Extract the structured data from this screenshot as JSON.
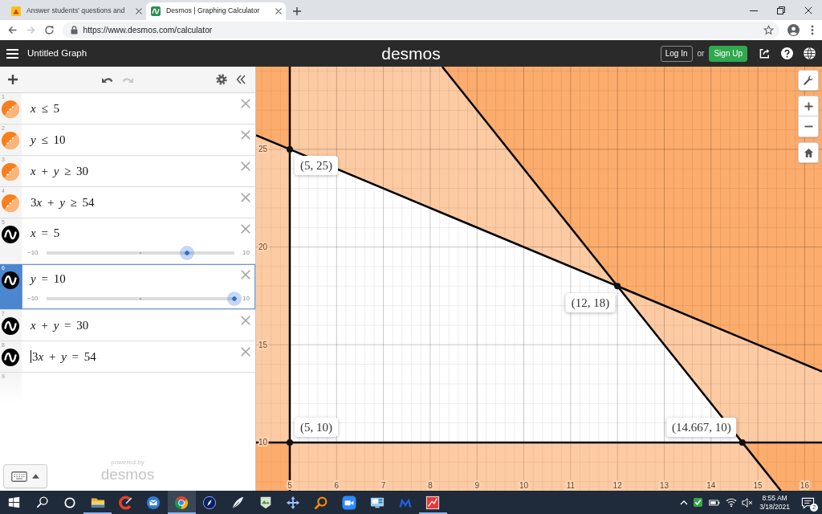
{
  "browser": {
    "tabs": [
      {
        "title": "Answer students' questions and",
        "selected": false
      },
      {
        "title": "Desmos | Graphing Calculator",
        "selected": true
      }
    ],
    "forward_disabled": true,
    "url": "https://www.desmos.com/calculator"
  },
  "header": {
    "title": "Untitled Graph",
    "logo": "desmos",
    "login": "Log In",
    "separator": "or",
    "signup": "Sign Up"
  },
  "toolbar": {
    "undo_disabled": false,
    "redo_disabled": true
  },
  "expressions": [
    {
      "number": "1",
      "kind": "inequality",
      "color": "#fa7e19",
      "latex": "x ≤ 5",
      "selected": false,
      "editing": false
    },
    {
      "number": "2",
      "kind": "inequality",
      "color": "#fa7e19",
      "latex": "y ≤ 10",
      "selected": false,
      "editing": false
    },
    {
      "number": "3",
      "kind": "inequality",
      "color": "#fa7e19",
      "shade_greater": true,
      "latex": "x + y ≥ 30",
      "selected": false,
      "editing": false
    },
    {
      "number": "4",
      "kind": "inequality",
      "color": "#fa7e19",
      "shade_greater": true,
      "latex": "3x + y ≥ 54",
      "selected": false,
      "editing": false
    },
    {
      "number": "5",
      "kind": "equation",
      "color": "#000000",
      "latex": "x = 5",
      "selected": false,
      "editing": false,
      "slider": {
        "min": "−10",
        "max": "10",
        "level": 0.75
      }
    },
    {
      "number": "6",
      "kind": "equation",
      "color": "#000000",
      "latex": "y = 10",
      "selected": true,
      "editing": false,
      "slider": {
        "min": "−10",
        "max": "10",
        "level": 1
      }
    },
    {
      "number": "7",
      "kind": "equation",
      "color": "#000000",
      "latex": "x + y = 30",
      "selected": false,
      "editing": false
    },
    {
      "number": "8",
      "kind": "equation",
      "color": "#000000",
      "latex": "3x + y = 54",
      "selected": false,
      "editing": true
    },
    {
      "number": "9",
      "kind": "empty",
      "selected": false,
      "editing": false
    }
  ],
  "footer": {
    "powered_by": "powered by",
    "logo": "desmos"
  },
  "graph": {
    "chart_data": {
      "type": "line",
      "grid": true,
      "x": [
        4.28,
        5,
        8.257,
        12,
        14.667,
        15.49,
        16.37
      ],
      "xlim": [
        4.28,
        16.37
      ],
      "ylim": [
        7.53,
        29.23
      ],
      "xticks": [
        {
          "value": 5,
          "label": "5"
        },
        {
          "value": 6,
          "label": "6"
        },
        {
          "value": 7,
          "label": "7"
        },
        {
          "value": 8,
          "label": "8"
        },
        {
          "value": 9,
          "label": "9"
        },
        {
          "value": 10,
          "label": "10"
        },
        {
          "value": 11,
          "label": "11"
        },
        {
          "value": 12,
          "label": "12"
        },
        {
          "value": 13,
          "label": "13"
        },
        {
          "value": 14,
          "label": "14"
        },
        {
          "value": 15,
          "label": "15"
        },
        {
          "value": 16,
          "label": "16"
        }
      ],
      "yticks": [
        {
          "value": 10,
          "label": "10"
        },
        {
          "value": 15,
          "label": "15"
        },
        {
          "value": 20,
          "label": "20"
        },
        {
          "value": 25,
          "label": "25"
        }
      ],
      "series": [
        {
          "color": "#000000",
          "values": [
            10,
            10,
            10,
            10,
            10,
            10,
            10
          ]
        },
        {
          "color": "#000000",
          "values": [
            25.72,
            25,
            21.74,
            18,
            15.33,
            14.51,
            13.63
          ]
        },
        {
          "color": "#000000",
          "values": [
            null,
            null,
            29.23,
            18,
            10,
            7.53,
            null
          ]
        }
      ],
      "ref_lines": [
        {
          "axis": "x",
          "value": 5,
          "color": "#000000"
        }
      ],
      "bands": [
        {
          "axis": "x",
          "from": 4.28,
          "to": 5,
          "color": "#fa7e19"
        },
        {
          "axis": "y",
          "from": 7.53,
          "to": 10,
          "color": "#fa7e19"
        }
      ],
      "annotations": [
        {
          "x": 5,
          "y": 25,
          "text": "(5, 25)"
        },
        {
          "x": 12,
          "y": 18,
          "text": "(12, 18)"
        },
        {
          "x": 5,
          "y": 10,
          "text": "(5, 10)"
        },
        {
          "x": 14.667,
          "y": 10,
          "text": "(14.667, 10)"
        }
      ]
    }
  },
  "taskbar": {
    "apps": [
      {
        "open": true,
        "selected": false
      },
      {
        "open": false,
        "selected": false
      },
      {
        "open": false,
        "selected": false
      },
      {
        "open": true,
        "selected": true
      },
      {
        "open": false,
        "selected": false
      },
      {
        "open": false,
        "selected": false
      },
      {
        "open": false,
        "selected": false
      },
      {
        "open": false,
        "selected": false
      },
      {
        "open": false,
        "selected": false
      },
      {
        "open": false,
        "selected": false
      },
      {
        "open": false,
        "selected": false
      },
      {
        "open": false,
        "selected": false
      },
      {
        "open": true,
        "selected": false
      }
    ],
    "time": "8:55 AM",
    "date": "3/18/2021",
    "notifications": "2"
  }
}
